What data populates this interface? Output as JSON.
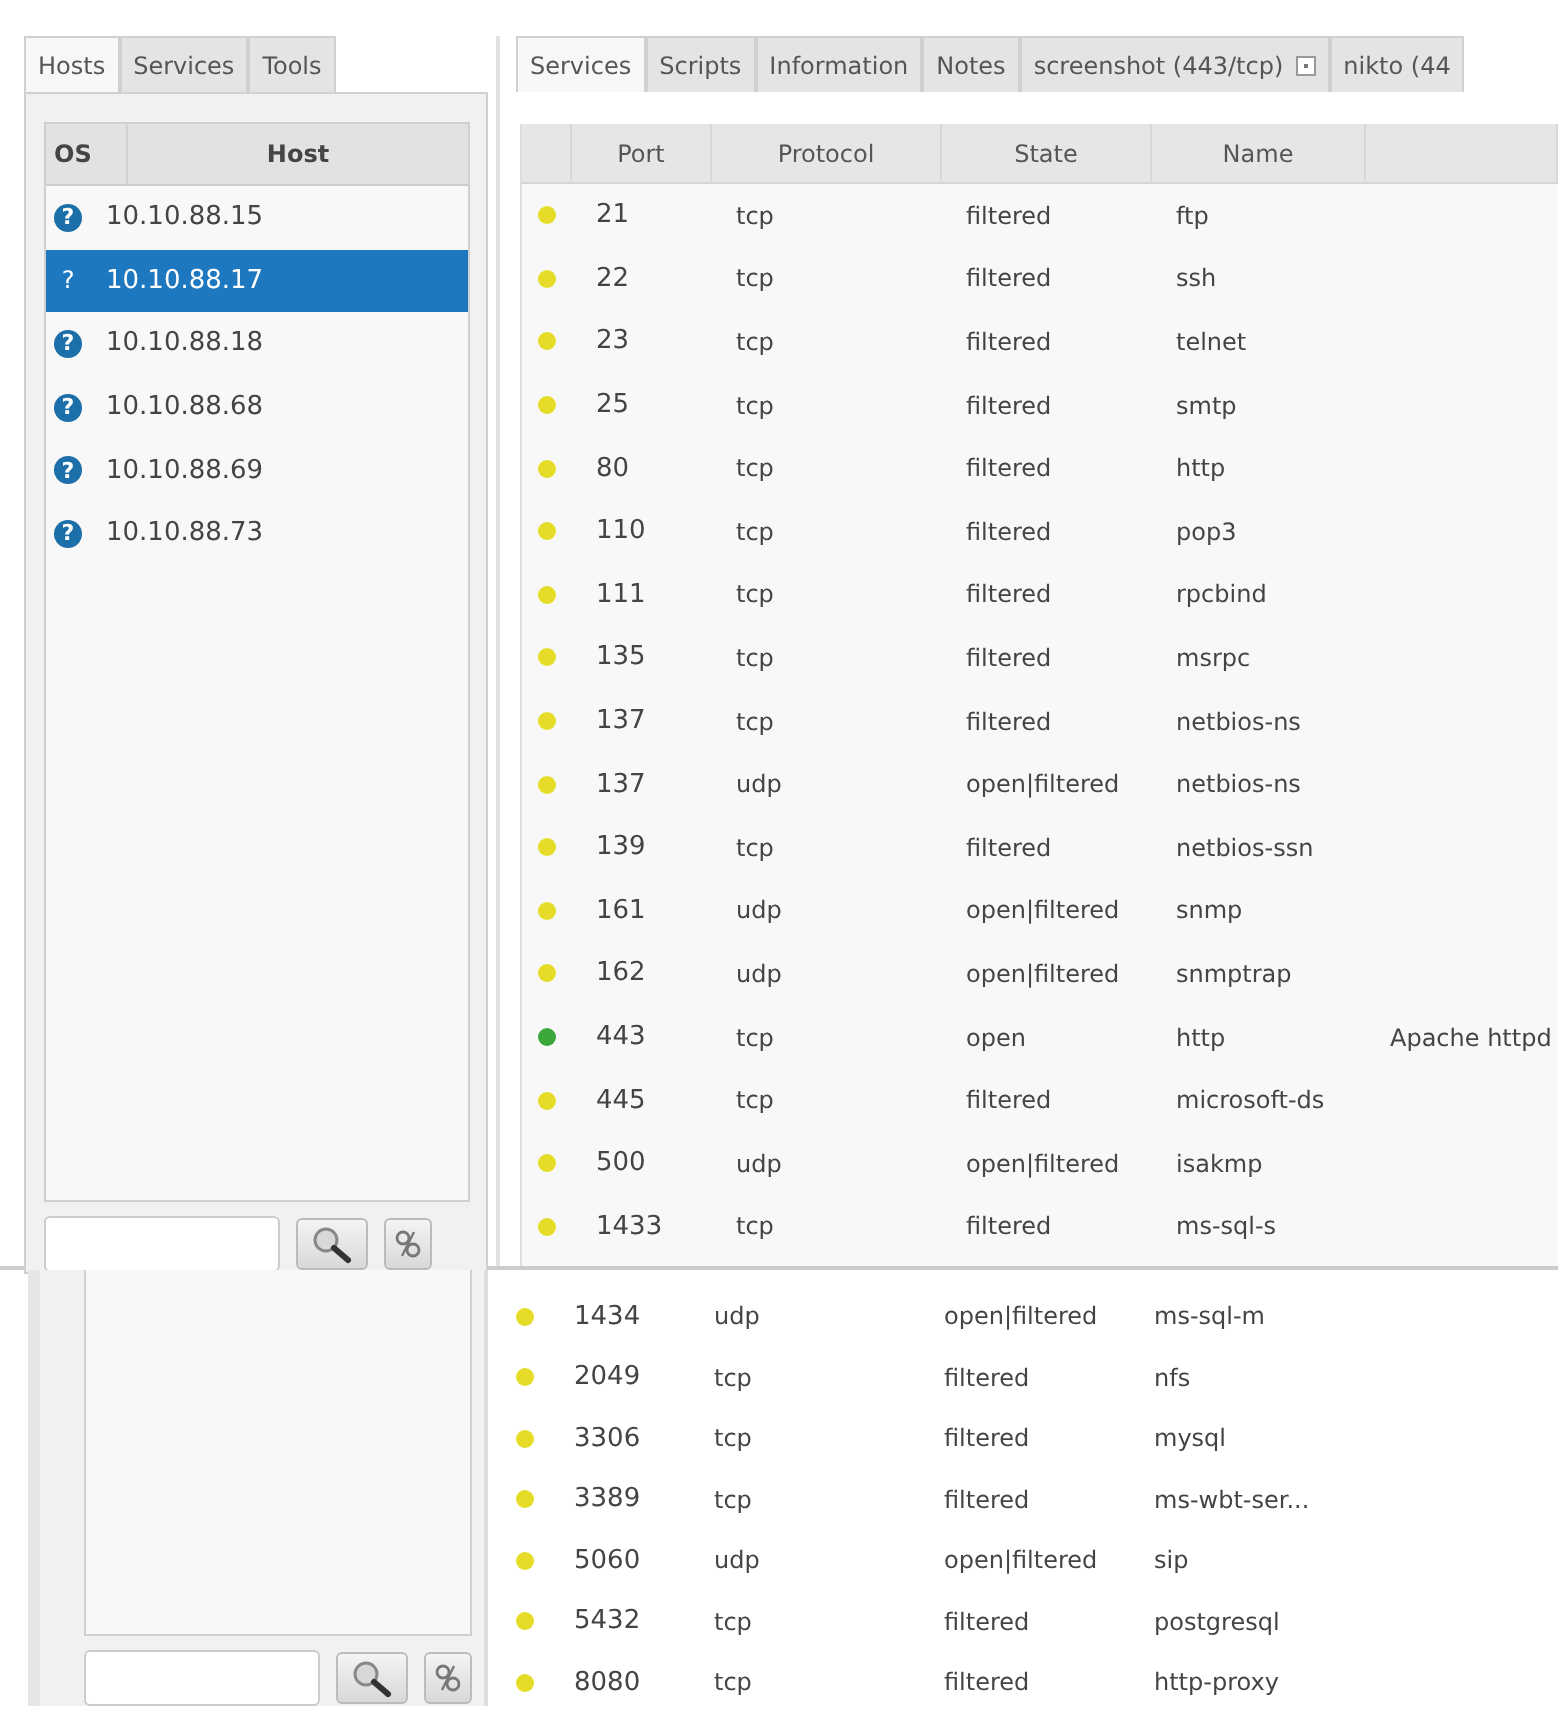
{
  "left_tabs": [
    {
      "label": "Hosts",
      "selected": true
    },
    {
      "label": "Services",
      "selected": false
    },
    {
      "label": "Tools",
      "selected": false
    }
  ],
  "hosts_table": {
    "columns": [
      "OS",
      "Host"
    ],
    "rows": [
      {
        "os": "?",
        "host": "10.10.88.15",
        "selected": false
      },
      {
        "os": "?",
        "host": "10.10.88.17",
        "selected": true
      },
      {
        "os": "?",
        "host": "10.10.88.18",
        "selected": false
      },
      {
        "os": "?",
        "host": "10.10.88.68",
        "selected": false
      },
      {
        "os": "?",
        "host": "10.10.88.69",
        "selected": false
      },
      {
        "os": "?",
        "host": "10.10.88.73",
        "selected": false
      }
    ]
  },
  "right_tabs": [
    {
      "label": "Services",
      "selected": true,
      "closable": false
    },
    {
      "label": "Scripts",
      "selected": false,
      "closable": false
    },
    {
      "label": "Information",
      "selected": false,
      "closable": false
    },
    {
      "label": "Notes",
      "selected": false,
      "closable": false
    },
    {
      "label": "screenshot (443/tcp)",
      "selected": false,
      "closable": true
    },
    {
      "label": "nikto (44",
      "selected": false,
      "closable": false
    }
  ],
  "services_table": {
    "columns": [
      "Port",
      "Protocol",
      "State",
      "Name"
    ],
    "rows": [
      {
        "color": "#e6dc28",
        "port": "21",
        "protocol": "tcp",
        "state": "filtered",
        "name": "ftp"
      },
      {
        "color": "#e6dc28",
        "port": "22",
        "protocol": "tcp",
        "state": "filtered",
        "name": "ssh"
      },
      {
        "color": "#e6dc28",
        "port": "23",
        "protocol": "tcp",
        "state": "filtered",
        "name": "telnet"
      },
      {
        "color": "#e6dc28",
        "port": "25",
        "protocol": "tcp",
        "state": "filtered",
        "name": "smtp"
      },
      {
        "color": "#e6dc28",
        "port": "80",
        "protocol": "tcp",
        "state": "filtered",
        "name": "http"
      },
      {
        "color": "#e6dc28",
        "port": "110",
        "protocol": "tcp",
        "state": "filtered",
        "name": "pop3"
      },
      {
        "color": "#e6dc28",
        "port": "111",
        "protocol": "tcp",
        "state": "filtered",
        "name": "rpcbind"
      },
      {
        "color": "#e6dc28",
        "port": "135",
        "protocol": "tcp",
        "state": "filtered",
        "name": "msrpc"
      },
      {
        "color": "#e6dc28",
        "port": "137",
        "protocol": "tcp",
        "state": "filtered",
        "name": "netbios-ns"
      },
      {
        "color": "#e6dc28",
        "port": "137",
        "protocol": "udp",
        "state": "open|filtered",
        "name": "netbios-ns"
      },
      {
        "color": "#e6dc28",
        "port": "139",
        "protocol": "tcp",
        "state": "filtered",
        "name": "netbios-ssn"
      },
      {
        "color": "#e6dc28",
        "port": "161",
        "protocol": "udp",
        "state": "open|filtered",
        "name": "snmp"
      },
      {
        "color": "#e6dc28",
        "port": "162",
        "protocol": "udp",
        "state": "open|filtered",
        "name": "snmptrap"
      },
      {
        "color": "#3ca83c",
        "port": "443",
        "protocol": "tcp",
        "state": "open",
        "name": "http",
        "column_5": "Apache httpd"
      },
      {
        "color": "#e6dc28",
        "port": "445",
        "protocol": "tcp",
        "state": "filtered",
        "name": "microsoft-ds"
      },
      {
        "color": "#e6dc28",
        "port": "500",
        "protocol": "udp",
        "state": "open|filtered",
        "name": "isakmp"
      },
      {
        "color": "#e6dc28",
        "port": "1433",
        "protocol": "tcp",
        "state": "filtered",
        "name": "ms-sql-s"
      }
    ]
  },
  "lower_services_rows": [
    {
      "color": "#e6dc28",
      "port": "1434",
      "protocol": "udp",
      "state": "open|filtered",
      "name": "ms-sql-m"
    },
    {
      "color": "#e6dc28",
      "port": "2049",
      "protocol": "tcp",
      "state": "filtered",
      "name": "nfs"
    },
    {
      "color": "#e6dc28",
      "port": "3306",
      "protocol": "tcp",
      "state": "filtered",
      "name": "mysql"
    },
    {
      "color": "#e6dc28",
      "port": "3389",
      "protocol": "tcp",
      "state": "filtered",
      "name": "ms-wbt-ser..."
    },
    {
      "color": "#e6dc28",
      "port": "5060",
      "protocol": "udp",
      "state": "open|filtered",
      "name": "sip"
    },
    {
      "color": "#e6dc28",
      "port": "5432",
      "protocol": "tcp",
      "state": "filtered",
      "name": "postgresql"
    },
    {
      "color": "#e6dc28",
      "port": "8080",
      "protocol": "tcp",
      "state": "filtered",
      "name": "http-proxy"
    }
  ]
}
